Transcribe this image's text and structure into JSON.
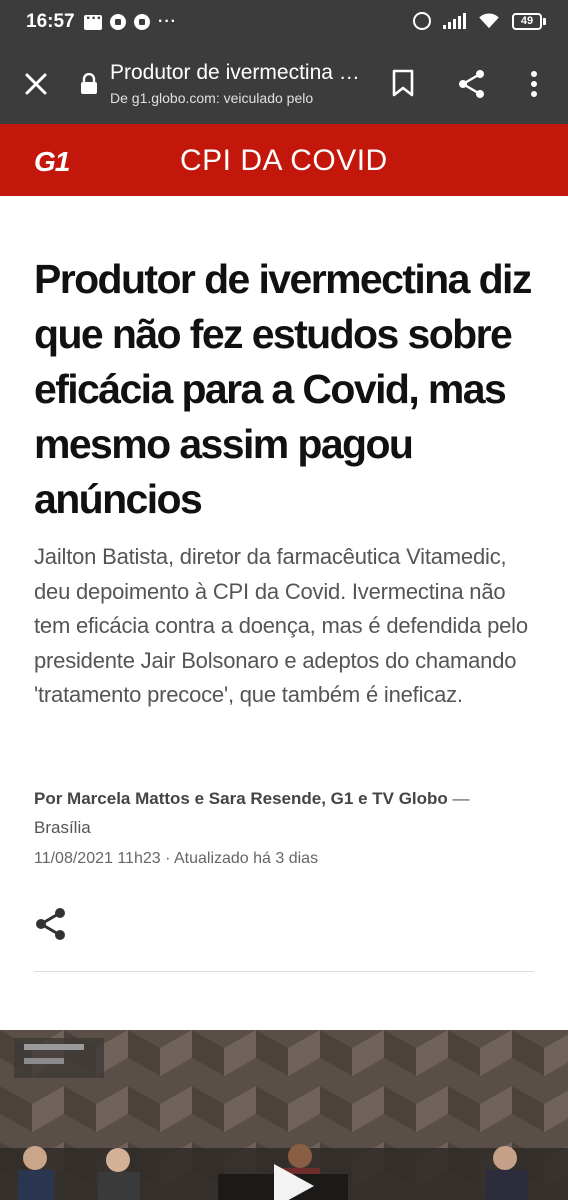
{
  "status_bar": {
    "time": "16:57",
    "left_icons": [
      "message-icon",
      "soccer-ball-icon",
      "soccer-ball-icon",
      "more-dots-icon"
    ],
    "right_icons": [
      "alarm-icon",
      "signal-icon",
      "wifi-icon",
      "battery-icon"
    ],
    "battery_level": "49"
  },
  "toolbar": {
    "page_title": "Produtor de ivermectina diz que não fez estudos sobre eficácia para a Covid, mas mesmo assim pagou anúncios",
    "url_line": "De g1.globo.com: veiculado pelo",
    "icons": [
      "close-icon",
      "lock-icon",
      "bookmark-icon",
      "share-icon",
      "more-vert-icon"
    ]
  },
  "section": {
    "logo_text": "G1",
    "title": "CPI DA COVID",
    "brand_color": "#c4170c"
  },
  "article": {
    "headline": "Produtor de ivermectina diz que não fez estudos sobre eficácia para a Covid, mas mesmo assim pagou anúncios",
    "subhead": "Jailton Batista, diretor da farmacêutica Vitamedic, deu depoimento à CPI da Covid. Ivermectina não tem eficácia contra a doença, mas é defendida pelo presidente Jair Bolsonaro e adeptos do chamando 'tratamento precoce', que também é ineficaz.",
    "byline_authors": "Por Marcela Mattos e Sara Resende, G1 e TV Globo",
    "byline_separator": " — ",
    "byline_location": "Brasília",
    "dateline": "11/08/2021 11h23 · Atualizado há 3 dias"
  },
  "video": {
    "icons": [
      "play-icon"
    ]
  }
}
